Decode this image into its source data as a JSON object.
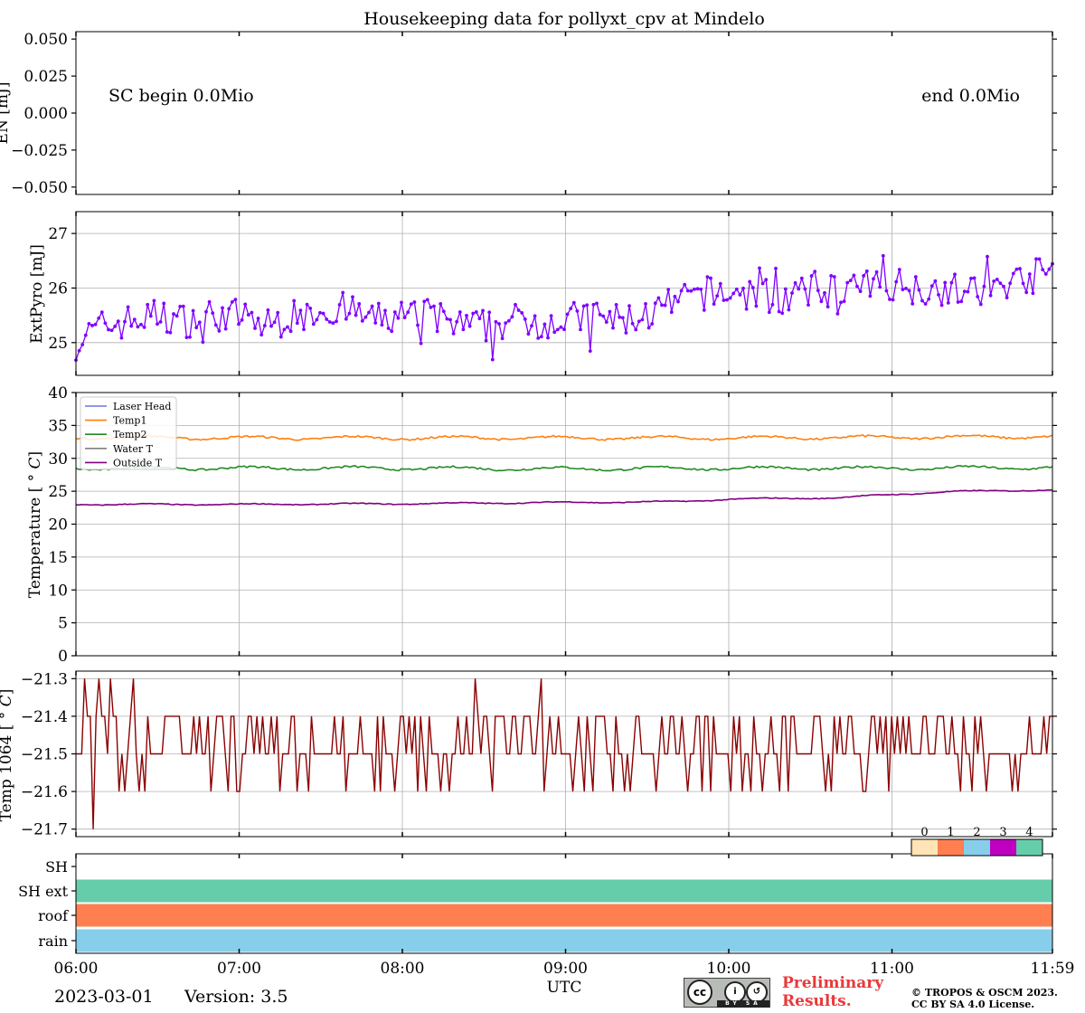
{
  "figure": {
    "title": "Housekeeping data for pollyxt_cpv at Mindelo",
    "date": "2023-03-01",
    "version": "Version: 3.5",
    "preliminary_line1": "Preliminary",
    "preliminary_line2": "Results.",
    "copyright_line1": "© TROPOS & OSCM 2023.",
    "copyright_line2": "CC BY SA 4.0 License.",
    "license_icon": "cc-by-sa-badge",
    "license_labels": [
      "BY",
      "SA"
    ]
  },
  "x_axis": {
    "label": "UTC",
    "range": [
      "06:00",
      "11:59"
    ],
    "ticks": [
      "06:00",
      "07:00",
      "08:00",
      "09:00",
      "10:00",
      "11:00",
      "11:59"
    ]
  },
  "chart_data": [
    {
      "id": "energy",
      "type": "line",
      "ylabel": "EN [mJ]",
      "ylim": [
        -0.055,
        0.055
      ],
      "yticks": [
        "0.050",
        "0.025",
        "0.000",
        "−0.025",
        "−0.050"
      ],
      "ytick_values": [
        0.05,
        0.025,
        0.0,
        -0.025,
        -0.05
      ],
      "grid": false,
      "annotations": [
        "SC begin 0.0Mio",
        "end 0.0Mio"
      ],
      "series": []
    },
    {
      "id": "extpyro",
      "type": "line",
      "ylabel": "ExtPyro [mJ]",
      "ylim": [
        24.4,
        27.4
      ],
      "yticks": [
        "25",
        "26",
        "27"
      ],
      "ytick_values": [
        25,
        26,
        27
      ],
      "grid": true,
      "series": [
        {
          "color": "#7f00ff",
          "marker": "dot",
          "x": [
            "06:00",
            "06:10",
            "06:20",
            "06:30",
            "06:40",
            "06:50",
            "07:00",
            "07:10",
            "07:20",
            "07:30",
            "07:40",
            "07:50",
            "08:00",
            "08:10",
            "08:20",
            "08:30",
            "08:40",
            "08:50",
            "09:00",
            "09:10",
            "09:20",
            "09:30",
            "09:40",
            "09:50",
            "10:00",
            "10:10",
            "10:20",
            "10:30",
            "10:40",
            "10:50",
            "11:00",
            "11:10",
            "11:20",
            "11:30",
            "11:40",
            "11:50",
            "11:59"
          ],
          "values": [
            25.0,
            25.3,
            25.4,
            25.5,
            25.4,
            25.5,
            25.5,
            25.3,
            25.5,
            25.6,
            25.6,
            25.4,
            25.5,
            25.5,
            25.3,
            25.3,
            25.4,
            25.4,
            25.4,
            25.5,
            25.4,
            25.5,
            25.7,
            25.9,
            25.9,
            25.9,
            25.8,
            25.9,
            26.0,
            26.0,
            26.1,
            26.0,
            26.0,
            25.9,
            26.0,
            26.2,
            26.3
          ],
          "noise_amplitude": 0.32
        }
      ]
    },
    {
      "id": "temperature",
      "type": "line",
      "ylabel": "Temperature [$^\\circ C$]",
      "ylim": [
        0,
        40
      ],
      "yticks": [
        "0",
        "5",
        "10",
        "15",
        "20",
        "25",
        "30",
        "35",
        "40"
      ],
      "ytick_values": [
        0,
        5,
        10,
        15,
        20,
        25,
        30,
        35,
        40
      ],
      "grid": true,
      "legend_placement": "top-left",
      "series": [
        {
          "name": "Laser Head",
          "color": "#6f76e0",
          "x": [],
          "values": []
        },
        {
          "name": "Temp1",
          "color": "#ff7f0e",
          "x": [
            "06:00",
            "07:00",
            "08:00",
            "09:00",
            "10:00",
            "11:00",
            "11:59"
          ],
          "values": [
            33.2,
            33.1,
            33.1,
            33.1,
            33.1,
            33.2,
            33.3
          ],
          "noise_amplitude": 0.3
        },
        {
          "name": "Temp2",
          "color": "#228b22",
          "x": [
            "06:00",
            "07:00",
            "08:00",
            "09:00",
            "10:00",
            "11:00",
            "11:59"
          ],
          "values": [
            28.5,
            28.5,
            28.5,
            28.4,
            28.5,
            28.5,
            28.6
          ],
          "noise_amplitude": 0.3
        },
        {
          "name": "Water T",
          "color": "#808080",
          "x": [],
          "values": []
        },
        {
          "name": "Outside T",
          "color": "#800080",
          "x": [
            "06:00",
            "07:00",
            "08:00",
            "09:00",
            "09:40",
            "10:00",
            "10:40",
            "11:00",
            "11:20",
            "11:40",
            "11:59"
          ],
          "values": [
            23.0,
            23.0,
            23.1,
            23.3,
            23.4,
            23.8,
            24.0,
            24.5,
            24.9,
            25.1,
            25.2
          ],
          "noise_amplitude": 0.12
        }
      ]
    },
    {
      "id": "temp1064",
      "type": "line",
      "ylabel": "Temp 1064 [$^\\circ C$]",
      "ylim": [
        -21.72,
        -21.28
      ],
      "yticks": [
        "−21.3",
        "−21.4",
        "−21.5",
        "−21.6",
        "−21.7"
      ],
      "ytick_values": [
        -21.3,
        -21.4,
        -21.5,
        -21.6,
        -21.7
      ],
      "grid": true,
      "series": [
        {
          "color": "#8b0000",
          "step_values": [
            -21.7,
            -21.6,
            -21.5,
            -21.4,
            -21.3
          ]
        }
      ]
    },
    {
      "id": "status",
      "type": "heatmap",
      "rows": [
        "SH",
        "SH ext",
        "roof",
        "rain"
      ],
      "row_states": [
        null,
        4,
        1,
        2
      ],
      "colorbar_ticks": [
        "0",
        "1",
        "2",
        "3",
        "4"
      ],
      "colorbar_colors": [
        "#ffe4b5",
        "#ff7f50",
        "#87ceeb",
        "#c000c0",
        "#66cdaa"
      ]
    }
  ]
}
